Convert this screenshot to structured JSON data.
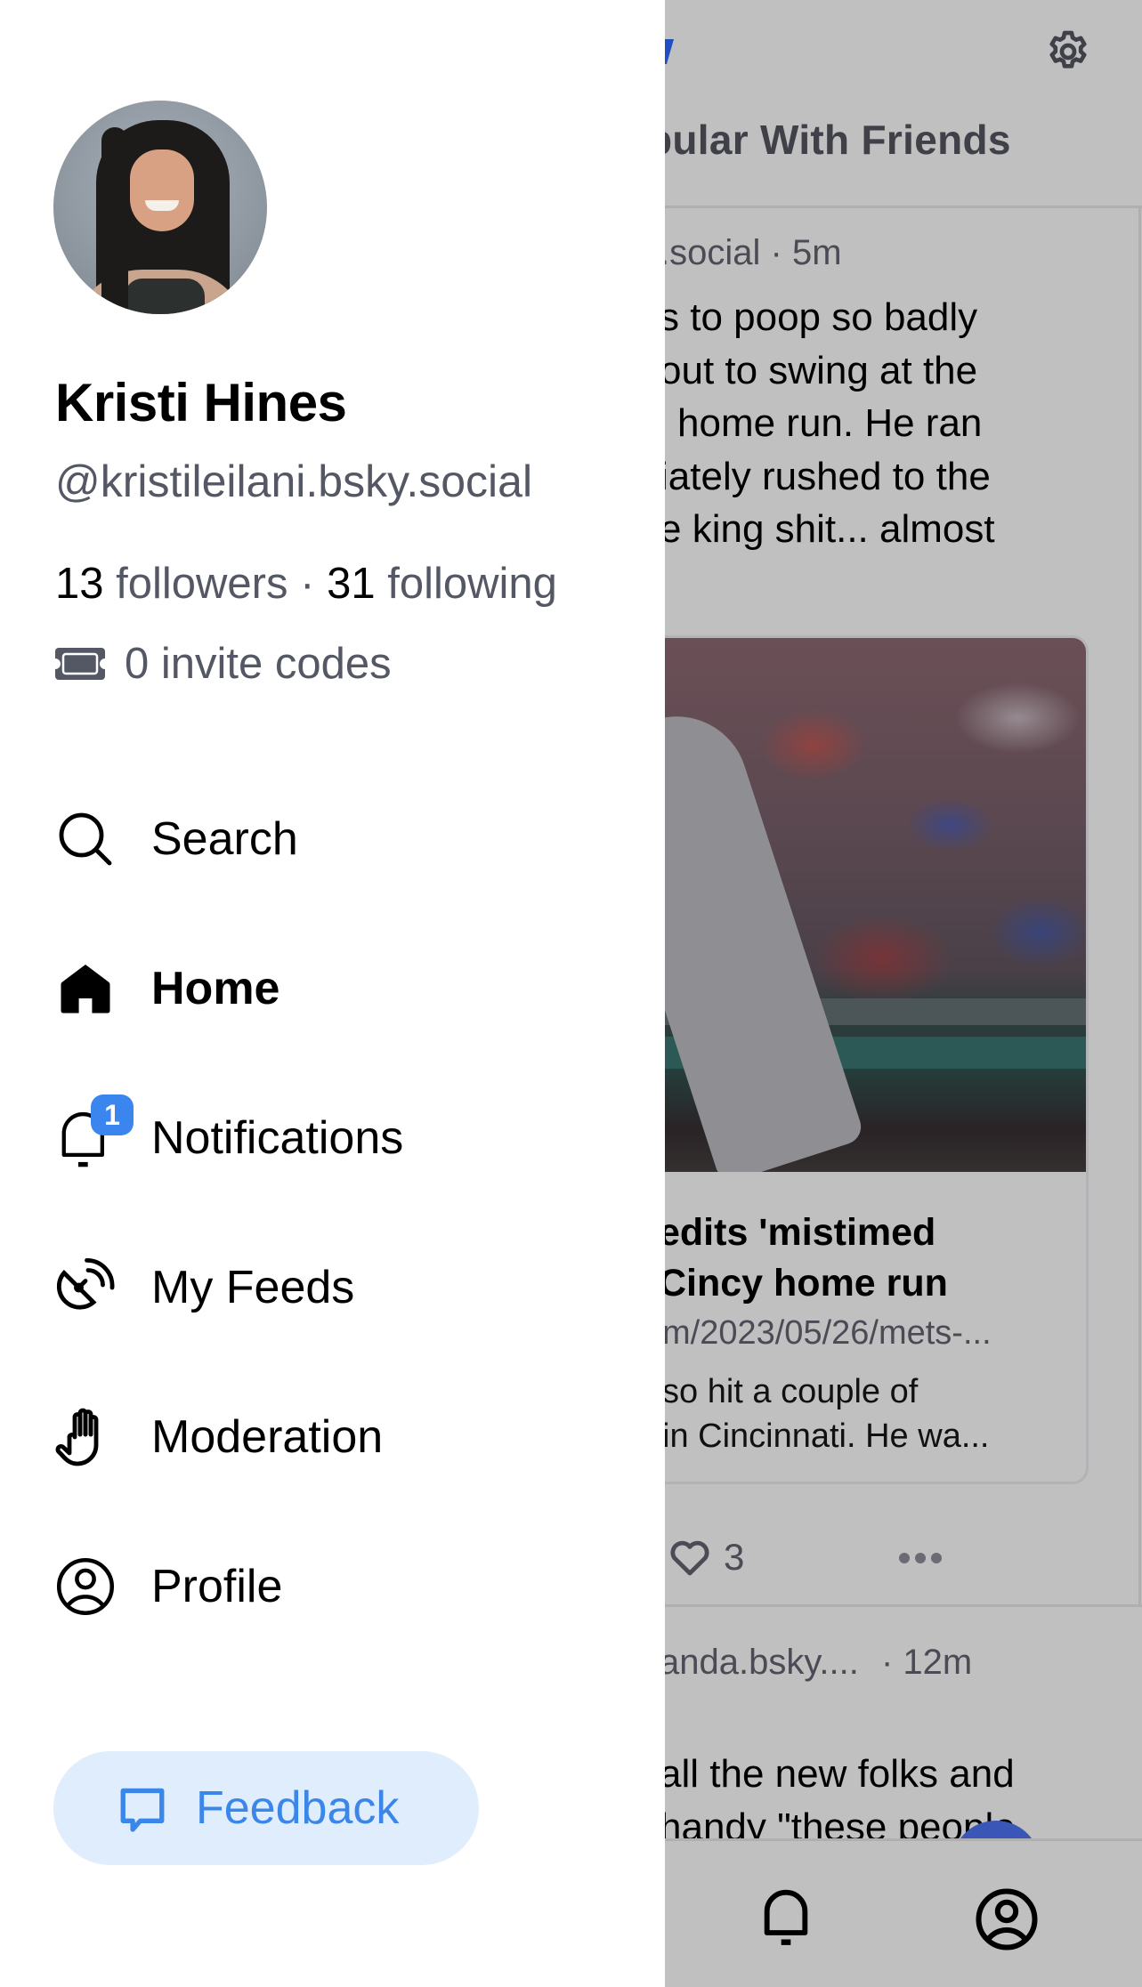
{
  "drawer": {
    "profile": {
      "display_name": "Kristi Hines",
      "handle": "@kristileilani.bsky.social",
      "followers_count": "13",
      "followers_label": "followers",
      "separator": "·",
      "following_count": "31",
      "following_label": "following",
      "invite_codes": "0 invite codes"
    },
    "nav": [
      {
        "label": "Search",
        "icon": "search-icon",
        "active": false
      },
      {
        "label": "Home",
        "icon": "home-icon",
        "active": true
      },
      {
        "label": "Notifications",
        "icon": "bell-icon",
        "active": false,
        "badge": "1"
      },
      {
        "label": "My Feeds",
        "icon": "satellite-dish-icon",
        "active": false
      },
      {
        "label": "Moderation",
        "icon": "hand-icon",
        "active": false
      },
      {
        "label": "Profile",
        "icon": "user-circle-icon",
        "active": false
      }
    ],
    "feedback_label": "Feedback"
  },
  "feed": {
    "title_fragment": "pular With Friends",
    "post1": {
      "handle_fragment": ".social",
      "time": "· 5m",
      "text_lines": [
        "s to poop so badly",
        "out to swing at the",
        "home run. He ran",
        "iately rushed to the",
        "e king shit... almost"
      ],
      "card": {
        "title_lines": [
          "edits 'mistimed",
          "Cincy home run"
        ],
        "url_fragment": "m/2023/05/26/mets-...",
        "desc_lines": [
          "so hit a couple of",
          "in Cincinnati. He wa..."
        ]
      },
      "like_count": "3"
    },
    "post2": {
      "handle_fragment": "anda.bsky....",
      "time": "· 12m",
      "text_lines": [
        "all the new folks and",
        "handy \"these people"
      ]
    }
  },
  "colors": {
    "accent": "#3b86e9",
    "badge": "#3b85ee",
    "feedback_bg": "#dfedfc",
    "muted_text": "#545864",
    "overlay": "#c0c0c0"
  }
}
